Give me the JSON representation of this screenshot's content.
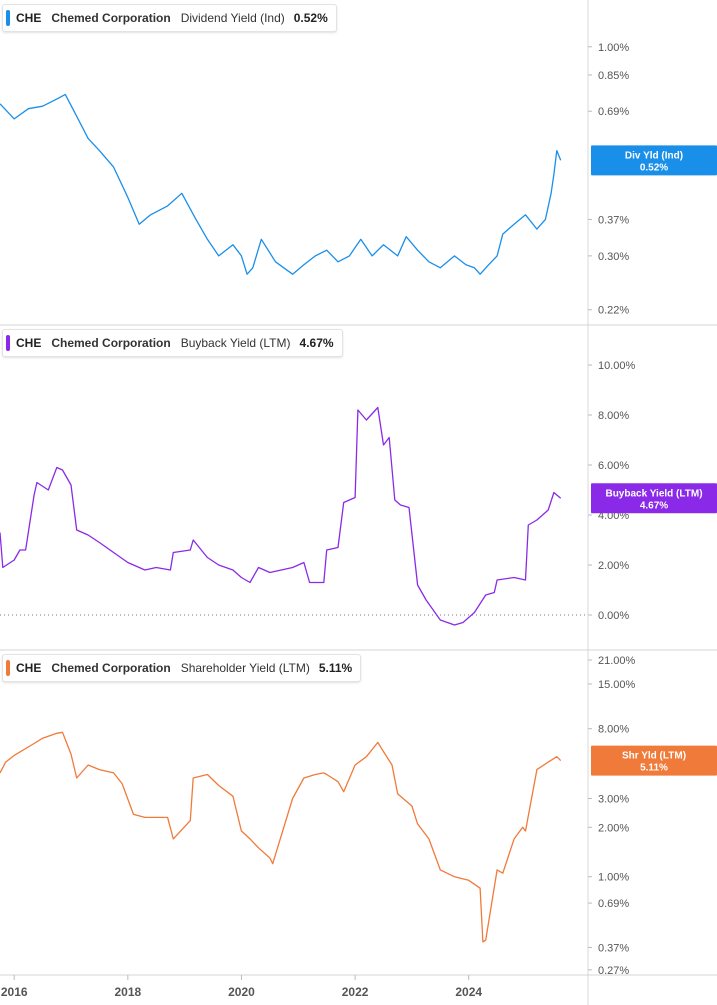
{
  "x_axis": {
    "ticks": [
      "2016",
      "2018",
      "2020",
      "2022",
      "2024"
    ],
    "range": [
      2015.75,
      2026.1
    ]
  },
  "chart_data": [
    {
      "type": "line",
      "ticker": "CHE",
      "company": "Chemed Corporation",
      "metric": "Dividend Yield (Ind)",
      "current_value": "0.52%",
      "tag_label": "Div Yld (Ind)",
      "color": "#1a8fea",
      "scale": "log",
      "ylim": [
        0.205,
        1.25
      ],
      "y_ticks": [
        {
          "label": "1.00%",
          "value": 1.0
        },
        {
          "label": "0.85%",
          "value": 0.85
        },
        {
          "label": "0.69%",
          "value": 0.69
        },
        {
          "label": "0.37%",
          "value": 0.37
        },
        {
          "label": "0.30%",
          "value": 0.3
        },
        {
          "label": "0.22%",
          "value": 0.22
        }
      ],
      "x": [
        2015.75,
        2016.0,
        2016.25,
        2016.5,
        2016.75,
        2016.9,
        2017.1,
        2017.3,
        2017.5,
        2017.75,
        2018.0,
        2018.2,
        2018.4,
        2018.7,
        2018.95,
        2019.2,
        2019.4,
        2019.6,
        2019.85,
        2020.0,
        2020.1,
        2020.2,
        2020.35,
        2020.6,
        2020.9,
        2021.1,
        2021.3,
        2021.5,
        2021.7,
        2021.9,
        2022.1,
        2022.3,
        2022.5,
        2022.75,
        2022.9,
        2023.1,
        2023.3,
        2023.5,
        2023.75,
        2023.95,
        2024.1,
        2024.2,
        2024.35,
        2024.5,
        2024.6,
        2024.8,
        2025.0,
        2025.2,
        2025.35,
        2025.45,
        2025.5,
        2025.55,
        2025.62
      ],
      "values": [
        0.72,
        0.66,
        0.7,
        0.71,
        0.74,
        0.76,
        0.67,
        0.59,
        0.55,
        0.5,
        0.42,
        0.36,
        0.38,
        0.4,
        0.43,
        0.37,
        0.33,
        0.3,
        0.32,
        0.3,
        0.27,
        0.28,
        0.33,
        0.29,
        0.27,
        0.285,
        0.3,
        0.31,
        0.29,
        0.3,
        0.33,
        0.3,
        0.32,
        0.3,
        0.335,
        0.31,
        0.29,
        0.28,
        0.3,
        0.285,
        0.28,
        0.27,
        0.285,
        0.3,
        0.34,
        0.36,
        0.38,
        0.35,
        0.37,
        0.43,
        0.48,
        0.55,
        0.52
      ]
    },
    {
      "type": "line",
      "ticker": "CHE",
      "company": "Chemed Corporation",
      "metric": "Buyback Yield (LTM)",
      "current_value": "4.67%",
      "tag_label": "Buyback Yield (LTM)",
      "color": "#8a2ae8",
      "scale": "linear",
      "ylim": [
        -1.0,
        11.0
      ],
      "zero_line": 0,
      "y_ticks": [
        {
          "label": "10.00%",
          "value": 10
        },
        {
          "label": "8.00%",
          "value": 8
        },
        {
          "label": "6.00%",
          "value": 6
        },
        {
          "label": "4.00%",
          "value": 4
        },
        {
          "label": "2.00%",
          "value": 2
        },
        {
          "label": "0.00%",
          "value": 0
        }
      ],
      "x": [
        2015.75,
        2015.8,
        2016.0,
        2016.1,
        2016.2,
        2016.35,
        2016.4,
        2016.6,
        2016.75,
        2016.85,
        2017.0,
        2017.1,
        2017.3,
        2017.5,
        2017.75,
        2018.0,
        2018.3,
        2018.5,
        2018.75,
        2018.8,
        2019.1,
        2019.15,
        2019.4,
        2019.6,
        2019.85,
        2020.0,
        2020.15,
        2020.3,
        2020.5,
        2020.9,
        2021.1,
        2021.2,
        2021.45,
        2021.5,
        2021.7,
        2021.8,
        2022.0,
        2022.05,
        2022.2,
        2022.4,
        2022.5,
        2022.6,
        2022.7,
        2022.8,
        2022.95,
        2023.1,
        2023.25,
        2023.5,
        2023.75,
        2023.9,
        2024.1,
        2024.3,
        2024.45,
        2024.5,
        2024.8,
        2025.0,
        2025.05,
        2025.2,
        2025.4,
        2025.5,
        2025.55,
        2025.62
      ],
      "values": [
        3.3,
        1.9,
        2.2,
        2.6,
        2.6,
        4.8,
        5.3,
        5.0,
        5.9,
        5.8,
        5.2,
        3.4,
        3.2,
        2.9,
        2.5,
        2.1,
        1.8,
        1.9,
        1.8,
        2.5,
        2.6,
        3.0,
        2.3,
        2.0,
        1.8,
        1.5,
        1.3,
        1.9,
        1.7,
        1.9,
        2.1,
        1.3,
        1.3,
        2.6,
        2.7,
        4.5,
        4.7,
        8.2,
        7.8,
        8.3,
        6.8,
        7.1,
        4.6,
        4.4,
        4.3,
        1.2,
        0.6,
        -0.2,
        -0.4,
        -0.3,
        0.1,
        0.8,
        0.9,
        1.4,
        1.5,
        1.4,
        3.6,
        3.8,
        4.2,
        4.9,
        4.8,
        4.67
      ]
    },
    {
      "type": "line",
      "ticker": "CHE",
      "company": "Chemed Corporation",
      "metric": "Shareholder Yield (LTM)",
      "current_value": "5.11%",
      "tag_label": "Shr Yld (LTM)",
      "color": "#f07a3a",
      "scale": "log",
      "ylim": [
        0.262,
        23.5
      ],
      "y_ticks": [
        {
          "label": "21.00%",
          "value": 21
        },
        {
          "label": "15.00%",
          "value": 15
        },
        {
          "label": "8.00%",
          "value": 8
        },
        {
          "label": "3.00%",
          "value": 3
        },
        {
          "label": "2.00%",
          "value": 2
        },
        {
          "label": "1.00%",
          "value": 1
        },
        {
          "label": "0.69%",
          "value": 0.69
        },
        {
          "label": "0.37%",
          "value": 0.37
        },
        {
          "label": "0.27%",
          "value": 0.27
        }
      ],
      "x": [
        2015.75,
        2015.85,
        2016.0,
        2016.35,
        2016.5,
        2016.75,
        2016.85,
        2017.0,
        2017.1,
        2017.3,
        2017.5,
        2017.75,
        2017.9,
        2018.1,
        2018.3,
        2018.7,
        2018.8,
        2019.1,
        2019.15,
        2019.4,
        2019.6,
        2019.85,
        2020.0,
        2020.15,
        2020.3,
        2020.5,
        2020.55,
        2020.9,
        2021.1,
        2021.3,
        2021.45,
        2021.5,
        2021.7,
        2021.8,
        2022.0,
        2022.2,
        2022.4,
        2022.5,
        2022.65,
        2022.75,
        2023.0,
        2023.1,
        2023.3,
        2023.5,
        2023.75,
        2024.0,
        2024.2,
        2024.25,
        2024.3,
        2024.5,
        2024.6,
        2024.8,
        2024.95,
        2025.0,
        2025.2,
        2025.4,
        2025.55,
        2025.62
      ],
      "values": [
        4.3,
        5.0,
        5.5,
        6.5,
        7.0,
        7.5,
        7.6,
        5.6,
        4.0,
        4.8,
        4.5,
        4.3,
        3.7,
        2.4,
        2.3,
        2.3,
        1.7,
        2.2,
        4.0,
        4.2,
        3.6,
        3.1,
        1.9,
        1.7,
        1.5,
        1.3,
        1.2,
        3.0,
        4.0,
        4.2,
        4.3,
        4.2,
        3.8,
        3.3,
        4.8,
        5.4,
        6.6,
        5.8,
        4.8,
        3.2,
        2.7,
        2.1,
        1.7,
        1.1,
        1.0,
        0.95,
        0.85,
        0.4,
        0.41,
        1.1,
        1.05,
        1.7,
        2.0,
        1.9,
        4.5,
        5.0,
        5.4,
        5.11
      ]
    }
  ]
}
